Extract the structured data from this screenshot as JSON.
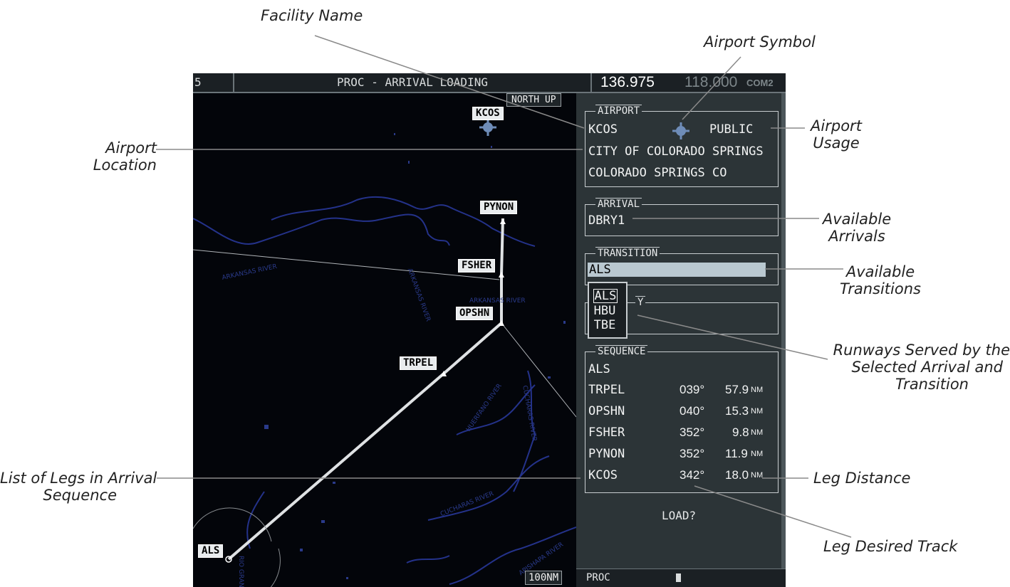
{
  "callouts": {
    "facility_name": "Facility Name",
    "airport_symbol": "Airport Symbol",
    "airport_location_1": "Airport",
    "airport_location_2": "Location",
    "airport_usage_1": "Airport",
    "airport_usage_2": "Usage",
    "available_arrivals_1": "Available",
    "available_arrivals_2": "Arrivals",
    "available_transitions_1": "Available",
    "available_transitions_2": "Transitions",
    "runways_served_1": "Runways Served by the",
    "runways_served_2": "Selected Arrival and",
    "runways_served_3": "Transition",
    "list_of_legs_1": "List of Legs in Arrival",
    "list_of_legs_2": "Sequence",
    "leg_distance": "Leg Distance",
    "leg_desired_track": "Leg Desired Track"
  },
  "topbar": {
    "left_fragment": "5",
    "title": "PROC - ARRIVAL LOADING",
    "active_freq": "136.975",
    "standby_freq": "118.000",
    "com_label": "COM2"
  },
  "map": {
    "orientation": "NORTH UP",
    "range": "100NM",
    "waypoints": {
      "kcos": "KCOS",
      "pynon": "PYNON",
      "fsher": "FSHER",
      "opshn": "OPSHN",
      "trpel": "TRPEL",
      "als": "ALS"
    },
    "rivers": {
      "arkansas_west": "ARKANSAS RIVER",
      "arkansas_vertical": "ARKANSAS RIVER",
      "arkansas_east": "ARKANSAS RIVER",
      "huerfano": "HUERFANO RIVER",
      "cucharas_vertical": "CUCHARAS RIVER",
      "cucharas": "CUCHARAS RIVER",
      "apishapa": "APISHAPA RIVER",
      "rio_grande": "RIO GRAND"
    }
  },
  "airport": {
    "title": "AIRPORT",
    "ident": "KCOS",
    "usage": "PUBLIC",
    "name": "CITY OF COLORADO SPRINGS",
    "location": "COLORADO SPRINGS CO"
  },
  "arrival": {
    "title": "ARRIVAL",
    "value": "DBRY1"
  },
  "transition": {
    "title": "TRANSITION",
    "value": "ALS",
    "options": [
      "ALS",
      "HBU",
      "TBE"
    ]
  },
  "runway": {
    "title_fragment": "Y"
  },
  "sequence": {
    "title": "SEQUENCE",
    "start": "ALS",
    "legs": [
      {
        "wpt": "TRPEL",
        "dtk": "039°",
        "dist": "57.9",
        "unit": "NM"
      },
      {
        "wpt": "OPSHN",
        "dtk": "040°",
        "dist": "15.3",
        "unit": "NM"
      },
      {
        "wpt": "FSHER",
        "dtk": "352°",
        "dist": "9.8",
        "unit": "NM"
      },
      {
        "wpt": "PYNON",
        "dtk": "352°",
        "dist": "11.9",
        "unit": "NM"
      },
      {
        "wpt": "KCOS",
        "dtk": "342°",
        "dist": "18.0",
        "unit": "NM"
      }
    ],
    "load_prompt": "LOAD?"
  },
  "footer": {
    "label": "PROC"
  },
  "colors": {
    "screen_bg": "#000000",
    "panel_bg": "#2c3437",
    "route": "#e6e6e6",
    "river": "#2a3a8a",
    "text": "#f2f3f3"
  }
}
